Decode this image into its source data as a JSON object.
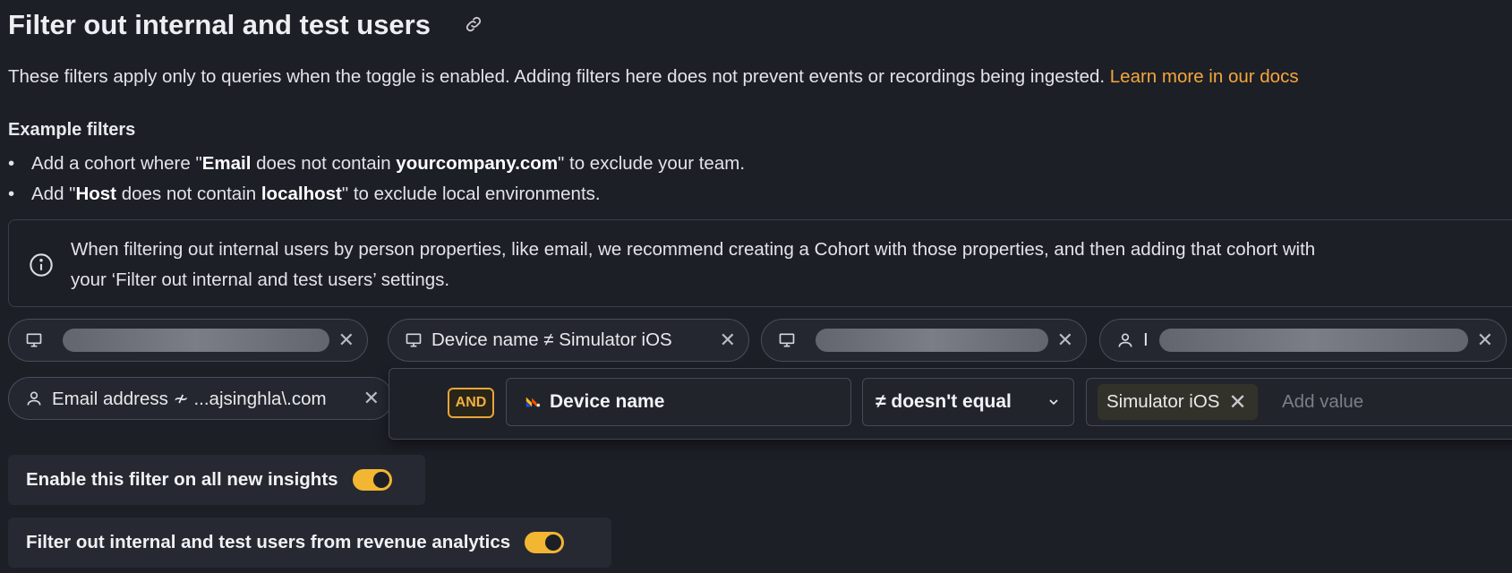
{
  "header": {
    "title": "Filter out internal and test users"
  },
  "intro": {
    "text": "These filters apply only to queries when the toggle is enabled. Adding filters here does not prevent events or recordings being ingested. ",
    "docs_link": "Learn more in our docs"
  },
  "examples": {
    "heading": "Example filters",
    "items": [
      {
        "p1": "Add a cohort where \"",
        "b1": "Email",
        "p2": " does not contain ",
        "b2": "yourcompany.com",
        "p3": "\" to exclude your team."
      },
      {
        "p1": "Add \"",
        "b1": "Host",
        "p2": " does not contain ",
        "b2": "localhost",
        "p3": "\" to exclude local environments."
      }
    ]
  },
  "info": {
    "line1": "When filtering out internal users by person properties, like email, we recommend creating a Cohort with those properties, and then adding that cohort with",
    "line2": "your ‘Filter out internal and test users’ settings."
  },
  "filters": [
    {
      "icon": "monitor-icon",
      "label": ""
    },
    {
      "icon": "monitor-icon",
      "label": "Device name ≠ Simulator iOS"
    },
    {
      "icon": "monitor-icon",
      "label": ""
    },
    {
      "icon": "person-icon",
      "label": "I"
    },
    {
      "icon": "person-icon",
      "label": "Email address ≁ ...ajsinghla\\.com"
    }
  ],
  "editor": {
    "and_label": "AND",
    "property": "Device name",
    "operator": "≠ doesn't equal",
    "value_tag": "Simulator iOS",
    "add_value_placeholder": "Add value"
  },
  "toggles": [
    {
      "label": "Enable this filter on all new insights",
      "on": true
    },
    {
      "label": "Filter out internal and test users from revenue analytics",
      "on": true
    }
  ],
  "colors": {
    "accent": "#f4a63a",
    "toggle_on": "#f2b632",
    "background": "#1d1f27"
  }
}
